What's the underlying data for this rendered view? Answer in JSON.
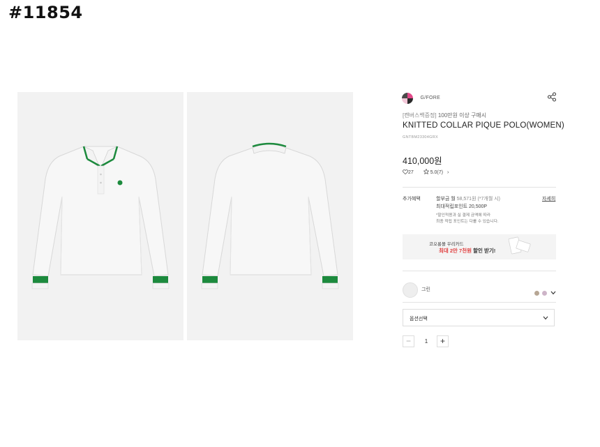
{
  "overlay": {
    "id_label": "#11854"
  },
  "product": {
    "brand": "G/FORE",
    "promo_tag": "[캔버스백증정]",
    "promo_text": " 100만원 이상 구매시",
    "title": "KNITTED COLLAR PIQUE POLO(WOMEN)",
    "sku": "GNTBM23304GRX",
    "price": "410,000원",
    "likes": "27",
    "rating": "5.0(7)",
    "rating_arrow": "›"
  },
  "benefits": {
    "label": "추가혜택",
    "installment": "할부금 월 ",
    "installment_amount": "58,571원 (*7개월 시)",
    "points": "최대적립포인트 20,500P",
    "note_line1": "*할인적용과 실 결제 금액에 따라",
    "note_line2": "최종 적립 포인트는 다를 수 있습니다.",
    "detail_link": "자세히"
  },
  "card_banner": {
    "line1": "코오롱몰 우리카드",
    "line2_red": "최대 2만 7천원",
    "line2_plain": " 할인 받기!"
  },
  "options": {
    "color_name": "그린",
    "swatch_colors": [
      "#b7a694",
      "#cdb4c8"
    ],
    "select_placeholder": "옵션선택",
    "quantity": "1",
    "minus": "−",
    "plus": "+"
  },
  "colors": {
    "polo_body": "#f7f7f7",
    "polo_accent": "#1c8a3d",
    "panel_bg": "#f2f2f2"
  },
  "icons": {
    "share": "share-icon",
    "heart": "heart-icon",
    "star": "star-icon",
    "chevron": "chevron-down-icon"
  }
}
